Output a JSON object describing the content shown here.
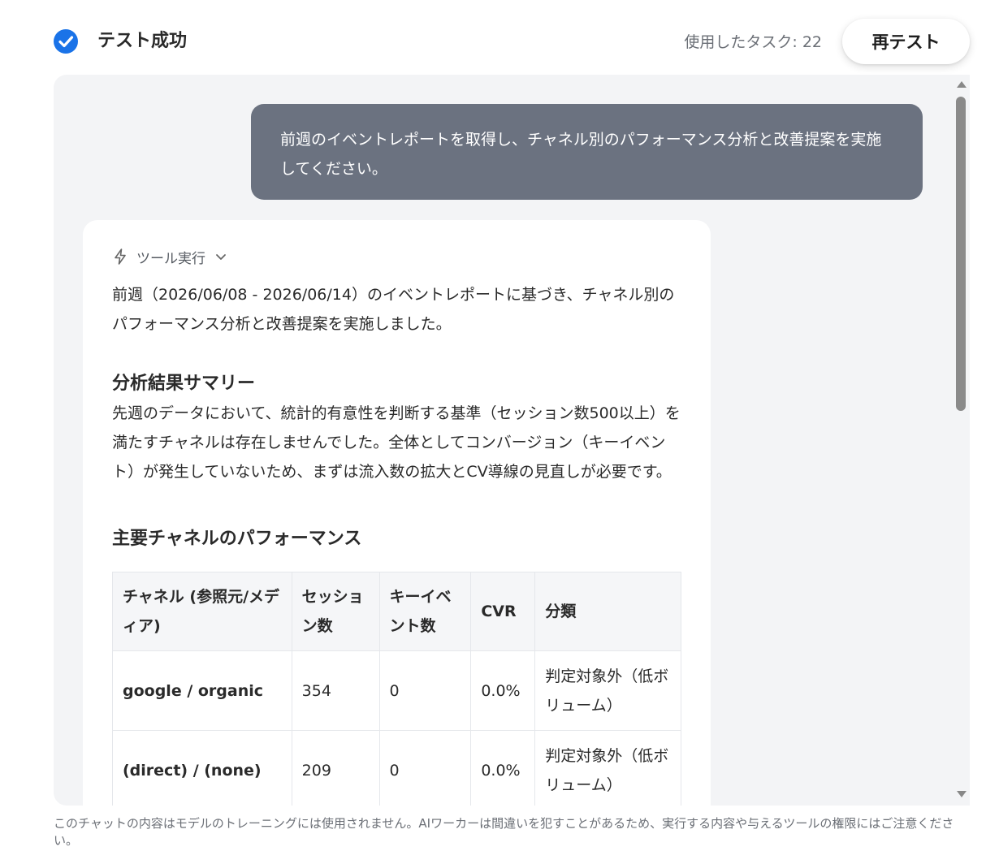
{
  "header": {
    "status": "テスト成功",
    "task_count": "使用したタスク: 22",
    "retest_label": "再テスト"
  },
  "chat": {
    "user_message": "前週のイベントレポートを取得し、チャネル別のパフォーマンス分析と改善提案を実施してください。",
    "tool_toggle_label": "ツール実行",
    "intro": "前週（2026/06/08 - 2026/06/14）のイベントレポートに基づき、チャネル別のパフォーマンス分析と改善提案を実施しました。",
    "summary_heading": "分析結果サマリー",
    "summary_text": "先週のデータにおいて、統計的有意性を判断する基準（セッション数500以上）を満たすチャネルは存在しませんでした。全体としてコンバージョン（キーイベント）が発生していないため、まずは流入数の拡大とCV導線の見直しが必要です。",
    "channel_heading": "主要チャネルのパフォーマンス",
    "table": {
      "headers": [
        "チャネル (参照元/メディア)",
        "セッション数",
        "キーイベント数",
        "CVR",
        "分類"
      ],
      "rows": [
        [
          "google / organic",
          "354",
          "0",
          "0.0%",
          "判定対象外（低ボリューム）"
        ],
        [
          "(direct) / (none)",
          "209",
          "0",
          "0.0%",
          "判定対象外（低ボリューム）"
        ]
      ]
    }
  },
  "footer": {
    "disclaimer": "このチャットの内容はモデルのトレーニングには使用されません。AIワーカーは間違いを犯すことがあるため、実行する内容や与えるツールの権限にはご注意ください。"
  },
  "colors": {
    "accent": "#1a73e8",
    "user_bubble": "#6b7280",
    "panel_bg": "#f3f4f6"
  },
  "icons": [
    "check-circle-icon",
    "lightning-icon",
    "chevron-down-icon"
  ]
}
